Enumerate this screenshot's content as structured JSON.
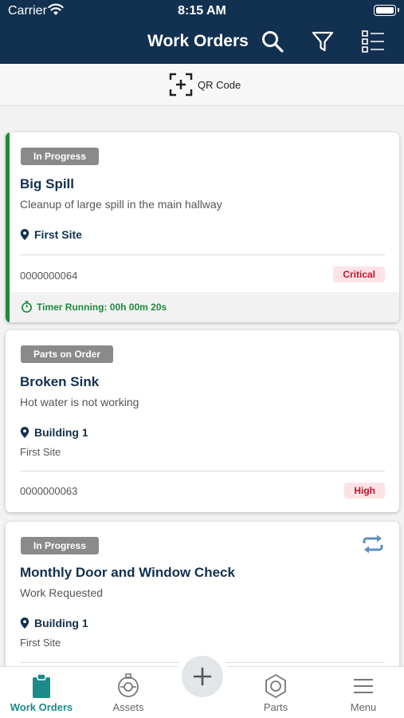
{
  "status_bar": {
    "carrier": "Carrier",
    "time": "8:15 AM"
  },
  "header": {
    "title": "Work Orders",
    "icons": [
      "search-icon",
      "filter-icon",
      "checklist-icon"
    ]
  },
  "qr": {
    "label": "QR Code",
    "icon": "qr-scan-icon"
  },
  "colors": {
    "header_bg": "#12304f",
    "accent_green": "#1f8a3e",
    "priority_red": "#c3122e",
    "tab_active": "#1d8a8a"
  },
  "work_orders": [
    {
      "status": "In Progress",
      "title": "Big Spill",
      "description": "Cleanup of large spill in the main hallway",
      "location": "First Site",
      "number": "0000000064",
      "priority": "Critical",
      "timer": "Timer Running: 00h 00m 20s"
    },
    {
      "status": "Parts on Order",
      "title": "Broken Sink",
      "description": "Hot water is not working",
      "location": "Building 1",
      "sub_location": "First Site",
      "number": "0000000063",
      "priority": "High"
    },
    {
      "status": "In Progress",
      "title": "Monthly Door and Window Check",
      "description": "Work Requested",
      "location": "Building 1",
      "sub_location": "First Site",
      "recurring_icon": "repeat-icon"
    }
  ],
  "tabbar": {
    "items": [
      {
        "label": "Work Orders",
        "icon": "clipboard-icon",
        "active": true
      },
      {
        "label": "Assets",
        "icon": "asset-icon"
      },
      {
        "label": "Parts",
        "icon": "hexagon-nut-icon"
      },
      {
        "label": "Menu",
        "icon": "hamburger-icon"
      }
    ],
    "fab_icon": "plus-icon"
  }
}
